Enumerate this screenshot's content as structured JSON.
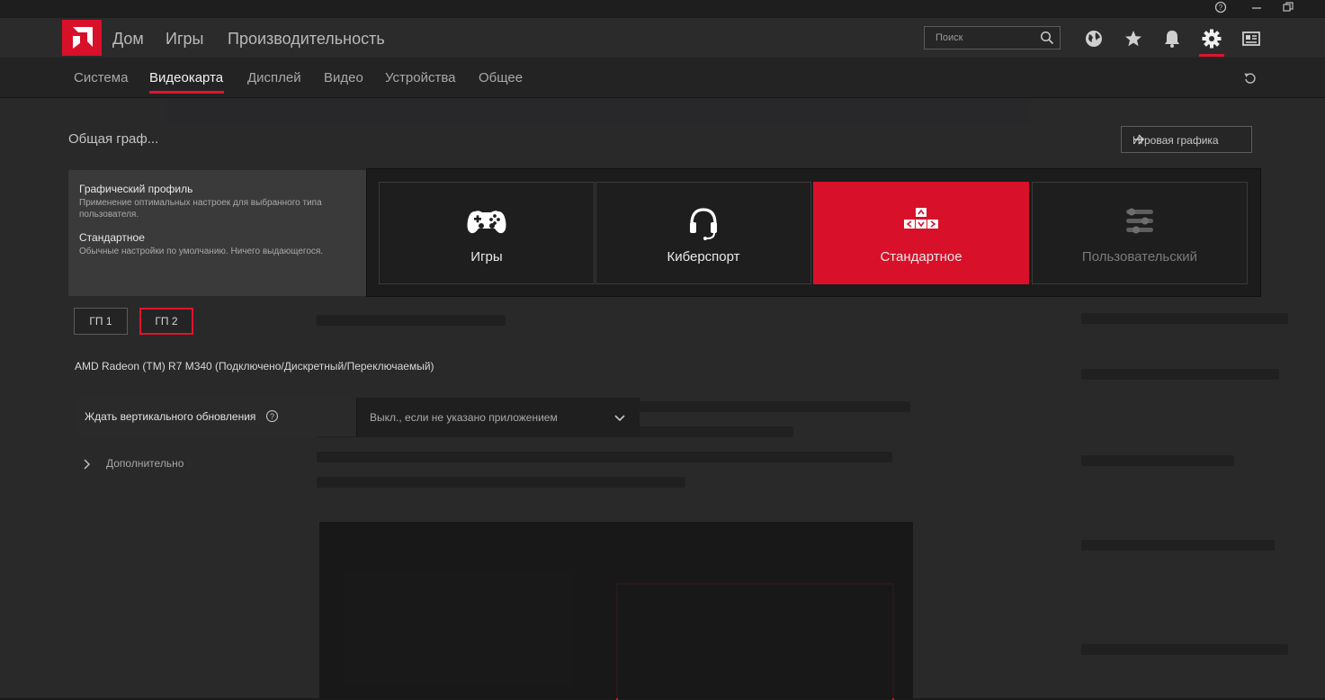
{
  "window": {
    "help_icon": "help-icon",
    "minimize_icon": "minimize-icon",
    "restore_icon": "restore-icon"
  },
  "topnav": {
    "items": [
      "Дом",
      "Игры",
      "Производительность"
    ],
    "search_placeholder": "Поиск",
    "icons": [
      "globe-icon",
      "star-icon",
      "bell-icon",
      "gear-icon",
      "news-icon"
    ],
    "active_icon": "gear-icon"
  },
  "subnav": {
    "items": [
      "Система",
      "Видеокарта",
      "Дисплей",
      "Видео",
      "Устройства",
      "Общее"
    ],
    "active": "Видеокарта"
  },
  "content": {
    "section_title": "Общая граф...",
    "game_graphics_button": "Игровая графика",
    "tooltip": {
      "heading1": "Графический профиль",
      "desc1": "Применение оптимальных настроек для выбранного типа пользователя.",
      "heading2": "Стандартное",
      "desc2": "Обычные настройки по умолчанию. Ничего выдающегося."
    },
    "profiles": [
      {
        "label": "Игры",
        "icon": "gamepad-icon"
      },
      {
        "label": "Киберспорт",
        "icon": "headset-icon"
      },
      {
        "label": "Стандартное",
        "icon": "keyboard-arrows-icon"
      },
      {
        "label": "Пользовательский",
        "icon": "sliders-icon"
      }
    ],
    "selected_profile": "Стандартное",
    "gpu_buttons": [
      "ГП 1",
      "ГП 2"
    ],
    "selected_gpu": "ГП 2",
    "gpu_name": "AMD Radeon (TM) R7 M340 (Подключено/Дискретный/Переключаемый)",
    "vsync_label": "Ждать вертикального обновления",
    "vsync_value": "Выкл., если не указано приложением",
    "advanced_label": "Дополнительно"
  },
  "colors": {
    "accent": "#d8102a",
    "background": "#1b1b1c",
    "panel": "#2a2a2b"
  }
}
